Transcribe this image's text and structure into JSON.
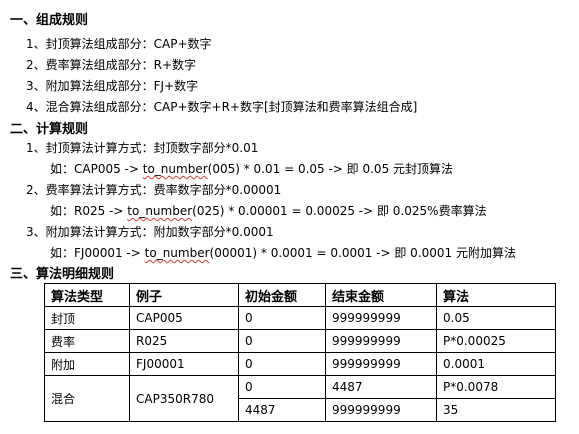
{
  "section1": {
    "title": "一、组成规则",
    "items": [
      "1、封顶算法组成部分：CAP+数字",
      "2、费率算法组成部分：R+数字",
      "3、附加算法组成部分：FJ+数字",
      "4、混合算法组成部分：CAP+数字+R+数字[封顶算法和费率算法组合成]"
    ]
  },
  "section2": {
    "title": "二、计算规则",
    "rules": [
      {
        "desc": "1、封顶算法计算方式：封顶数字部分*0.01",
        "ex_prefix": "如：CAP005 -> ",
        "ex_fn": "to_number",
        "ex_rest": "(005) * 0.01 = 0.05 -> 即 0.05 元封顶算法"
      },
      {
        "desc": "2、费率算法计算方式：费率数字部分*0.00001",
        "ex_prefix": "如：R025 -> ",
        "ex_fn": "to_number",
        "ex_rest": "(025) * 0.00001 = 0.00025 -> 即 0.025%费率算法"
      },
      {
        "desc": "3、附加算法计算方式：附加数字部分*0.0001",
        "ex_prefix": "如：FJ00001 -> ",
        "ex_fn": "to_number",
        "ex_rest": "(00001) * 0.0001 = 0.0001 -> 即 0.0001 元附加算法"
      }
    ]
  },
  "section3": {
    "title": "三、算法明细规则",
    "table": {
      "headers": [
        "算法类型",
        "例子",
        "初始金额",
        "结束金额",
        "算法"
      ],
      "rows": [
        [
          "封顶",
          "CAP005",
          "0",
          "999999999",
          "0.05"
        ],
        [
          "费率",
          "R025",
          "0",
          "999999999",
          "P*0.00025"
        ],
        [
          "附加",
          "FJ00001",
          "0",
          "999999999",
          "0.0001"
        ]
      ],
      "mixed": {
        "type": "混合",
        "example": "CAP350R780",
        "subrows": [
          [
            "0",
            "4487",
            "P*0.0078"
          ],
          [
            "4487",
            "999999999",
            "35"
          ]
        ]
      }
    }
  }
}
